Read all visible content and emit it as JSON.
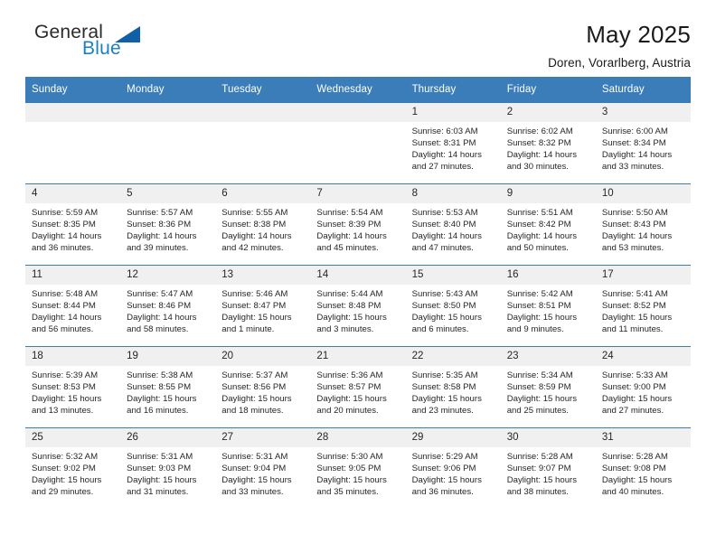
{
  "brand": {
    "name_top": "General",
    "name_bottom": "Blue",
    "accent_color": "#1b7fc4",
    "triangle_color": "#1060a8"
  },
  "header": {
    "title": "May 2025",
    "subtitle": "Doren, Vorarlberg, Austria"
  },
  "calendar": {
    "header_bg": "#3b7db9",
    "header_text_color": "#ffffff",
    "daynum_bg": "#f0f0f0",
    "weekdays": [
      "Sunday",
      "Monday",
      "Tuesday",
      "Wednesday",
      "Thursday",
      "Friday",
      "Saturday"
    ],
    "weeks": [
      [
        {
          "day": "",
          "blank": true,
          "sunrise": "",
          "sunset": "",
          "daylight_line1": "",
          "daylight_line2": ""
        },
        {
          "day": "",
          "blank": true,
          "sunrise": "",
          "sunset": "",
          "daylight_line1": "",
          "daylight_line2": ""
        },
        {
          "day": "",
          "blank": true,
          "sunrise": "",
          "sunset": "",
          "daylight_line1": "",
          "daylight_line2": ""
        },
        {
          "day": "",
          "blank": true,
          "sunrise": "",
          "sunset": "",
          "daylight_line1": "",
          "daylight_line2": ""
        },
        {
          "day": "1",
          "blank": false,
          "sunrise": "Sunrise: 6:03 AM",
          "sunset": "Sunset: 8:31 PM",
          "daylight_line1": "Daylight: 14 hours",
          "daylight_line2": "and 27 minutes."
        },
        {
          "day": "2",
          "blank": false,
          "sunrise": "Sunrise: 6:02 AM",
          "sunset": "Sunset: 8:32 PM",
          "daylight_line1": "Daylight: 14 hours",
          "daylight_line2": "and 30 minutes."
        },
        {
          "day": "3",
          "blank": false,
          "sunrise": "Sunrise: 6:00 AM",
          "sunset": "Sunset: 8:34 PM",
          "daylight_line1": "Daylight: 14 hours",
          "daylight_line2": "and 33 minutes."
        }
      ],
      [
        {
          "day": "4",
          "blank": false,
          "sunrise": "Sunrise: 5:59 AM",
          "sunset": "Sunset: 8:35 PM",
          "daylight_line1": "Daylight: 14 hours",
          "daylight_line2": "and 36 minutes."
        },
        {
          "day": "5",
          "blank": false,
          "sunrise": "Sunrise: 5:57 AM",
          "sunset": "Sunset: 8:36 PM",
          "daylight_line1": "Daylight: 14 hours",
          "daylight_line2": "and 39 minutes."
        },
        {
          "day": "6",
          "blank": false,
          "sunrise": "Sunrise: 5:55 AM",
          "sunset": "Sunset: 8:38 PM",
          "daylight_line1": "Daylight: 14 hours",
          "daylight_line2": "and 42 minutes."
        },
        {
          "day": "7",
          "blank": false,
          "sunrise": "Sunrise: 5:54 AM",
          "sunset": "Sunset: 8:39 PM",
          "daylight_line1": "Daylight: 14 hours",
          "daylight_line2": "and 45 minutes."
        },
        {
          "day": "8",
          "blank": false,
          "sunrise": "Sunrise: 5:53 AM",
          "sunset": "Sunset: 8:40 PM",
          "daylight_line1": "Daylight: 14 hours",
          "daylight_line2": "and 47 minutes."
        },
        {
          "day": "9",
          "blank": false,
          "sunrise": "Sunrise: 5:51 AM",
          "sunset": "Sunset: 8:42 PM",
          "daylight_line1": "Daylight: 14 hours",
          "daylight_line2": "and 50 minutes."
        },
        {
          "day": "10",
          "blank": false,
          "sunrise": "Sunrise: 5:50 AM",
          "sunset": "Sunset: 8:43 PM",
          "daylight_line1": "Daylight: 14 hours",
          "daylight_line2": "and 53 minutes."
        }
      ],
      [
        {
          "day": "11",
          "blank": false,
          "sunrise": "Sunrise: 5:48 AM",
          "sunset": "Sunset: 8:44 PM",
          "daylight_line1": "Daylight: 14 hours",
          "daylight_line2": "and 56 minutes."
        },
        {
          "day": "12",
          "blank": false,
          "sunrise": "Sunrise: 5:47 AM",
          "sunset": "Sunset: 8:46 PM",
          "daylight_line1": "Daylight: 14 hours",
          "daylight_line2": "and 58 minutes."
        },
        {
          "day": "13",
          "blank": false,
          "sunrise": "Sunrise: 5:46 AM",
          "sunset": "Sunset: 8:47 PM",
          "daylight_line1": "Daylight: 15 hours",
          "daylight_line2": "and 1 minute."
        },
        {
          "day": "14",
          "blank": false,
          "sunrise": "Sunrise: 5:44 AM",
          "sunset": "Sunset: 8:48 PM",
          "daylight_line1": "Daylight: 15 hours",
          "daylight_line2": "and 3 minutes."
        },
        {
          "day": "15",
          "blank": false,
          "sunrise": "Sunrise: 5:43 AM",
          "sunset": "Sunset: 8:50 PM",
          "daylight_line1": "Daylight: 15 hours",
          "daylight_line2": "and 6 minutes."
        },
        {
          "day": "16",
          "blank": false,
          "sunrise": "Sunrise: 5:42 AM",
          "sunset": "Sunset: 8:51 PM",
          "daylight_line1": "Daylight: 15 hours",
          "daylight_line2": "and 9 minutes."
        },
        {
          "day": "17",
          "blank": false,
          "sunrise": "Sunrise: 5:41 AM",
          "sunset": "Sunset: 8:52 PM",
          "daylight_line1": "Daylight: 15 hours",
          "daylight_line2": "and 11 minutes."
        }
      ],
      [
        {
          "day": "18",
          "blank": false,
          "sunrise": "Sunrise: 5:39 AM",
          "sunset": "Sunset: 8:53 PM",
          "daylight_line1": "Daylight: 15 hours",
          "daylight_line2": "and 13 minutes."
        },
        {
          "day": "19",
          "blank": false,
          "sunrise": "Sunrise: 5:38 AM",
          "sunset": "Sunset: 8:55 PM",
          "daylight_line1": "Daylight: 15 hours",
          "daylight_line2": "and 16 minutes."
        },
        {
          "day": "20",
          "blank": false,
          "sunrise": "Sunrise: 5:37 AM",
          "sunset": "Sunset: 8:56 PM",
          "daylight_line1": "Daylight: 15 hours",
          "daylight_line2": "and 18 minutes."
        },
        {
          "day": "21",
          "blank": false,
          "sunrise": "Sunrise: 5:36 AM",
          "sunset": "Sunset: 8:57 PM",
          "daylight_line1": "Daylight: 15 hours",
          "daylight_line2": "and 20 minutes."
        },
        {
          "day": "22",
          "blank": false,
          "sunrise": "Sunrise: 5:35 AM",
          "sunset": "Sunset: 8:58 PM",
          "daylight_line1": "Daylight: 15 hours",
          "daylight_line2": "and 23 minutes."
        },
        {
          "day": "23",
          "blank": false,
          "sunrise": "Sunrise: 5:34 AM",
          "sunset": "Sunset: 8:59 PM",
          "daylight_line1": "Daylight: 15 hours",
          "daylight_line2": "and 25 minutes."
        },
        {
          "day": "24",
          "blank": false,
          "sunrise": "Sunrise: 5:33 AM",
          "sunset": "Sunset: 9:00 PM",
          "daylight_line1": "Daylight: 15 hours",
          "daylight_line2": "and 27 minutes."
        }
      ],
      [
        {
          "day": "25",
          "blank": false,
          "sunrise": "Sunrise: 5:32 AM",
          "sunset": "Sunset: 9:02 PM",
          "daylight_line1": "Daylight: 15 hours",
          "daylight_line2": "and 29 minutes."
        },
        {
          "day": "26",
          "blank": false,
          "sunrise": "Sunrise: 5:31 AM",
          "sunset": "Sunset: 9:03 PM",
          "daylight_line1": "Daylight: 15 hours",
          "daylight_line2": "and 31 minutes."
        },
        {
          "day": "27",
          "blank": false,
          "sunrise": "Sunrise: 5:31 AM",
          "sunset": "Sunset: 9:04 PM",
          "daylight_line1": "Daylight: 15 hours",
          "daylight_line2": "and 33 minutes."
        },
        {
          "day": "28",
          "blank": false,
          "sunrise": "Sunrise: 5:30 AM",
          "sunset": "Sunset: 9:05 PM",
          "daylight_line1": "Daylight: 15 hours",
          "daylight_line2": "and 35 minutes."
        },
        {
          "day": "29",
          "blank": false,
          "sunrise": "Sunrise: 5:29 AM",
          "sunset": "Sunset: 9:06 PM",
          "daylight_line1": "Daylight: 15 hours",
          "daylight_line2": "and 36 minutes."
        },
        {
          "day": "30",
          "blank": false,
          "sunrise": "Sunrise: 5:28 AM",
          "sunset": "Sunset: 9:07 PM",
          "daylight_line1": "Daylight: 15 hours",
          "daylight_line2": "and 38 minutes."
        },
        {
          "day": "31",
          "blank": false,
          "sunrise": "Sunrise: 5:28 AM",
          "sunset": "Sunset: 9:08 PM",
          "daylight_line1": "Daylight: 15 hours",
          "daylight_line2": "and 40 minutes."
        }
      ]
    ]
  }
}
